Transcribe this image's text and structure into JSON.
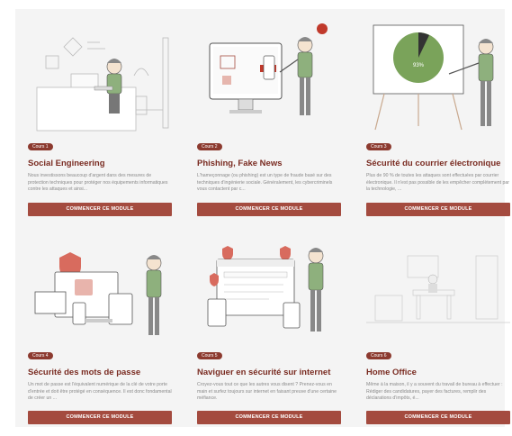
{
  "accent": "#a44b3f",
  "badge_color": "#8c3a2f",
  "title_color": "#7a2c22",
  "courses": [
    {
      "badge": "Cours 1",
      "title": "Social Engineering",
      "desc": "Nous investissons beaucoup d'argent dans des mesures de protection techniques pour protéger nos équipements informatiques contre les attaques et ainsi...",
      "button": "COMMENCER CE MODULE",
      "illustration": "man-at-desk"
    },
    {
      "badge": "Cours 2",
      "title": "Phishing, Fake News",
      "desc": "L'hameçonnage (ou phishing) est un type de fraude basé sur des techniques d'ingénierie sociale. Généralement, les cybercriminels vous contactent par c...",
      "button": "COMMENCER CE MODULE",
      "illustration": "phishing-monitor"
    },
    {
      "badge": "Cours 3",
      "title": "Sécurité du courrier électronique",
      "desc": "Plus de 90 % de toutes les attaques sont effectuées par courrier électronique. Il n'est pas possible de les empêcher complètement par la technologie, ...",
      "button": "COMMENCER CE MODULE",
      "illustration": "pie-chart-presentation",
      "pie_label": "93%"
    },
    {
      "badge": "Cours 4",
      "title": "Sécurité des mots de passe",
      "desc": "Un mot de passe est l'équivalent numérique de la clé de votre porte d'entrée et doit être protégé en conséquence. Il est donc fondamental de créer un ...",
      "button": "COMMENCER CE MODULE",
      "illustration": "locked-devices"
    },
    {
      "badge": "Cours 5",
      "title": "Naviguer en sécurité sur internet",
      "desc": "Croyez-vous tout ce que les autres vous disent ? Prenez-vous en main et surfez toujours sur internet en faisant preuve d'une certaine méfiance.",
      "button": "COMMENCER CE MODULE",
      "illustration": "secure-browser"
    },
    {
      "badge": "Cours 6",
      "title": "Home Office",
      "desc": "Même à la maison, il y a souvent du travail de bureau à effectuer : Rédiger des candidatures, payer des factures, remplir des déclarations d'impôts, é...",
      "button": "COMMENCER CE MODULE",
      "illustration": "home-office"
    }
  ]
}
